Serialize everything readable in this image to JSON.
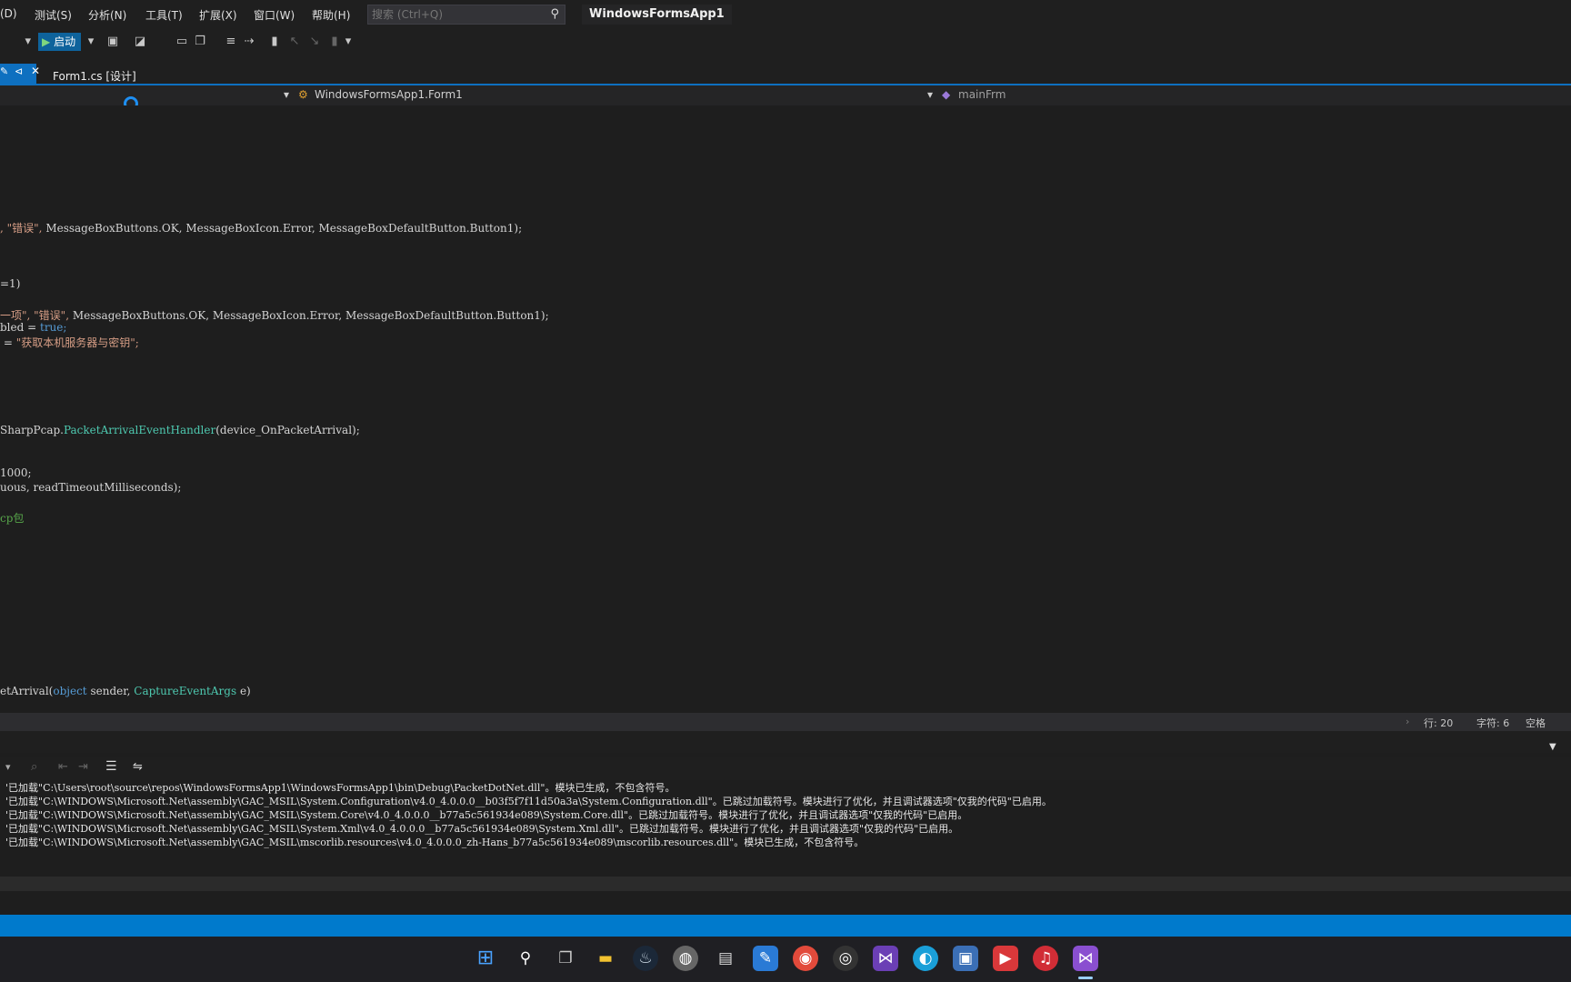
{
  "menu": {
    "items": [
      "(D)",
      "测试(S)",
      "分析(N)",
      "工具(T)",
      "扩展(X)",
      "窗口(W)",
      "帮助(H)"
    ],
    "search_placeholder": "搜索 (Ctrl+Q)",
    "app_title": "WindowsFormsApp1"
  },
  "toolbar": {
    "start_label": "启动"
  },
  "tabs": {
    "active_title": "Form1.cs [设计]"
  },
  "navbar": {
    "class_label": "WindowsFormsApp1.Form1",
    "member_label": "mainFrm"
  },
  "code": {
    "l1a": ", \"错误\", ",
    "l1b": "MessageBoxButtons.OK, MessageBoxIcon.Error, MessageBoxDefaultButton.Button1);",
    "l2": "=1)",
    "l3a": "一项\", \"错误\", ",
    "l3b": "MessageBoxButtons.OK, MessageBoxIcon.Error, MessageBoxDefaultButton.Button1);",
    "l4a": "bled = ",
    "l4b": "true;",
    "l5a": " = ",
    "l5b": "\"获取本机服务器与密钥\";",
    "l6a": "SharpPcap.",
    "l6b": "PacketArrivalEventHandler",
    "l6c": "(device_OnPacketArrival);",
    "l7": "1000;",
    "l8": "uous, readTimeoutMilliseconds);",
    "l9": "cp包",
    "l10a": "etArrival(",
    "l10b": "object",
    "l10c": " sender, ",
    "l10d": "CaptureEventArgs",
    "l10e": " e)"
  },
  "editor_status": {
    "line": "行: 20",
    "char": "字符: 6",
    "spaces": "空格"
  },
  "output": {
    "lines": [
      "'已加载\"C:\\Users\\root\\source\\repos\\WindowsFormsApp1\\WindowsFormsApp1\\bin\\Debug\\PacketDotNet.dll\"。模块已生成，不包含符号。",
      "'已加载\"C:\\WINDOWS\\Microsoft.Net\\assembly\\GAC_MSIL\\System.Configuration\\v4.0_4.0.0.0__b03f5f7f11d50a3a\\System.Configuration.dll\"。已跳过加载符号。模块进行了优化，并且调试器选项\"仅我的代码\"已启用。",
      "'已加载\"C:\\WINDOWS\\Microsoft.Net\\assembly\\GAC_MSIL\\System.Core\\v4.0_4.0.0.0__b77a5c561934e089\\System.Core.dll\"。已跳过加载符号。模块进行了优化，并且调试器选项\"仅我的代码\"已启用。",
      "'已加载\"C:\\WINDOWS\\Microsoft.Net\\assembly\\GAC_MSIL\\System.Xml\\v4.0_4.0.0.0__b77a5c561934e089\\System.Xml.dll\"。已跳过加载符号。模块进行了优化，并且调试器选项\"仅我的代码\"已启用。",
      "'已加载\"C:\\WINDOWS\\Microsoft.Net\\assembly\\GAC_MSIL\\mscorlib.resources\\v4.0_4.0.0.0_zh-Hans_b77a5c561934e089\\mscorlib.resources.dll\"。模块已生成，不包含符号。"
    ]
  },
  "colors": {
    "accent": "#007acc",
    "editor_bg": "#1e1e1e",
    "chrome_bg": "#1f1f1f"
  },
  "taskbar_icons": [
    "windows-start-icon",
    "search-icon",
    "task-view-icon",
    "file-explorer-icon",
    "steam-icon",
    "disk-icon",
    "monitor-icon",
    "notepad-icon",
    "chrome-icon",
    "obs-icon",
    "visual-studio-code-icon",
    "edge-icon",
    "remote-desktop-icon",
    "recorder-icon",
    "netease-music-icon",
    "visual-studio-icon"
  ]
}
